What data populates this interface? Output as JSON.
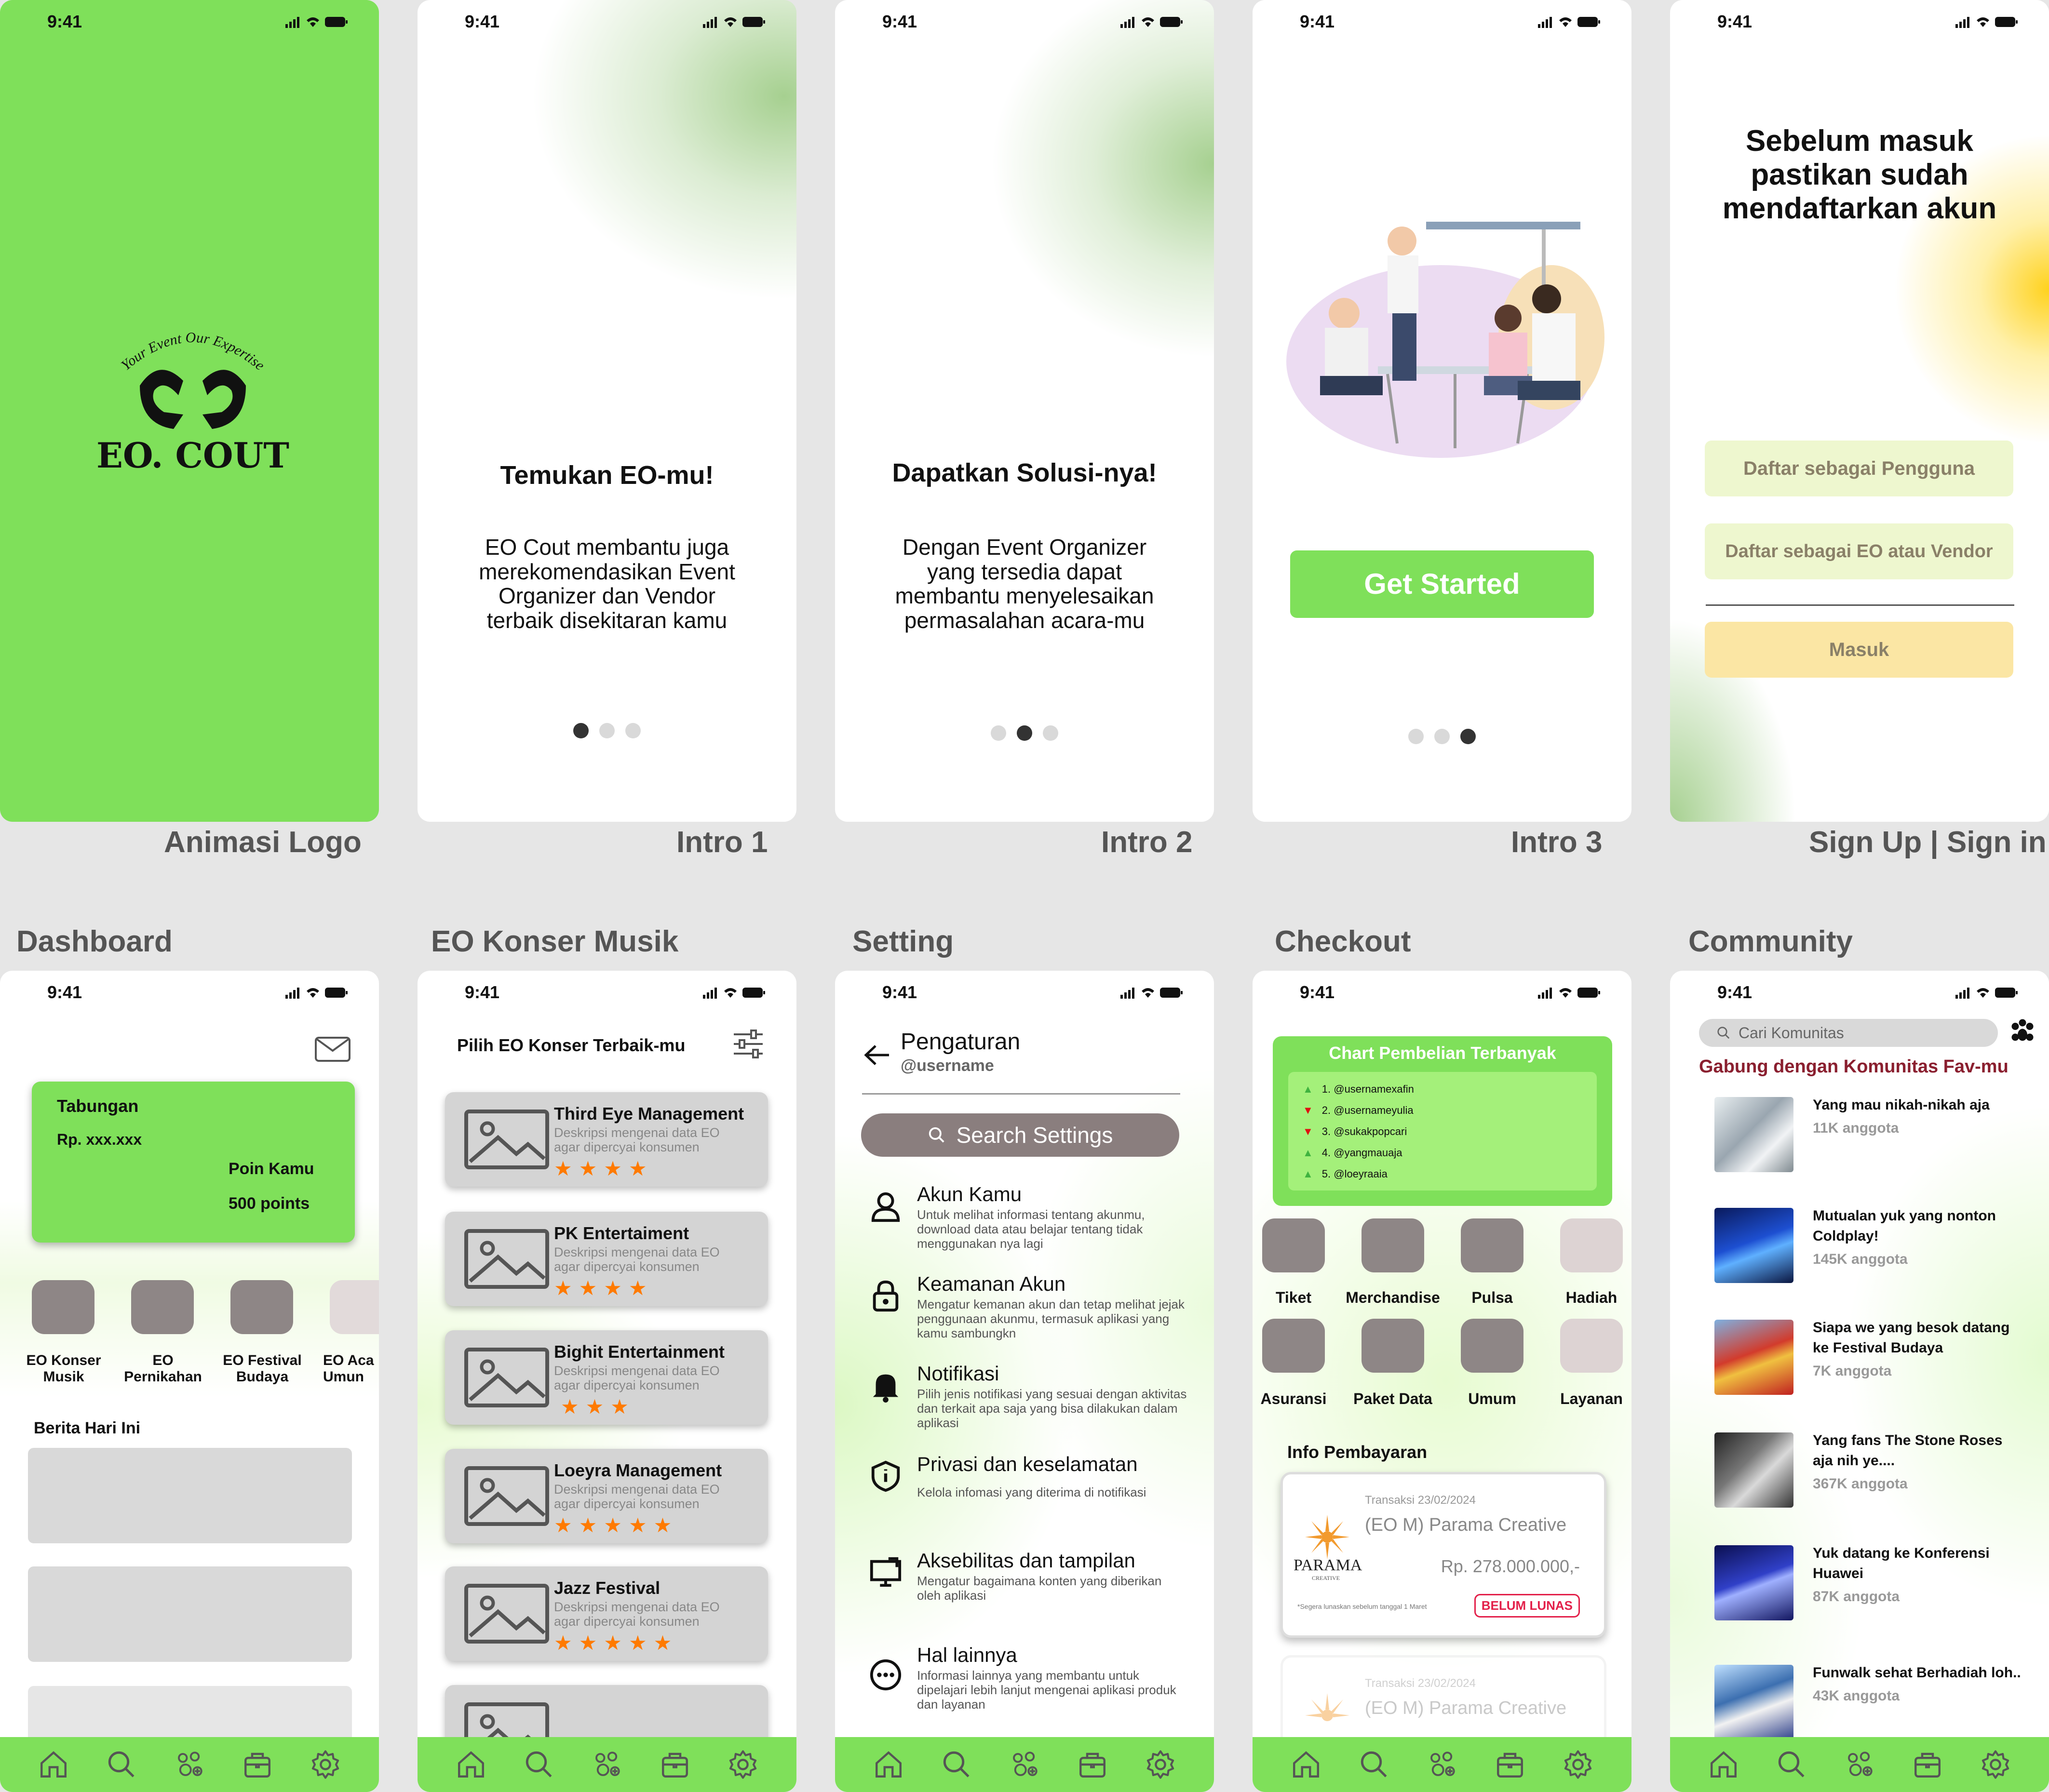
{
  "status_time": "9:41",
  "captions": {
    "logo": "Animasi Logo",
    "intro1": "Intro 1",
    "intro2": "Intro 2",
    "intro3": "Intro 3",
    "signup": "Sign Up | Sign in",
    "dashboard": "Dashboard",
    "eo_musik": "EO Konser Musik",
    "setting": "Setting",
    "checkout": "Checkout",
    "community": "Community"
  },
  "logo": {
    "tagline": "Your Event Our Expertise",
    "name": "EO. COUT",
    "bg": "#7fe05a"
  },
  "intro1": {
    "title": "Temukan EO-mu!",
    "body": "EO Cout membantu juga merekomendasikan Event Organizer dan Vendor terbaik disekitaran kamu"
  },
  "intro2": {
    "title": "Dapatkan Solusi-nya!",
    "body": "Dengan Event Organizer yang tersedia dapat membantu menyelesaikan permasalahan acara-mu"
  },
  "intro3": {
    "button": "Get Started"
  },
  "signup": {
    "title": "Sebelum masuk pastikan sudah mendaftarkan akun",
    "btn_user": "Daftar sebagai Pengguna",
    "btn_eo": "Daftar sebagai EO atau Vendor",
    "btn_login": "Masuk"
  },
  "dashboard": {
    "savings_label": "Tabungan",
    "savings_value": "Rp. xxx.xxx",
    "points_label": "Poin Kamu",
    "points_value": "500 points",
    "categories": [
      "EO Konser Musik",
      "EO Pernikahan",
      "EO Festival Budaya",
      "EO Aca Umun"
    ],
    "news_title": "Berita Hari Ini"
  },
  "eo_musik": {
    "title": "Pilih EO Konser Terbaik-mu",
    "desc": "Deskripsi mengenai data EO agar dipercyai konsumen",
    "items": [
      {
        "name": "Third Eye Management",
        "stars": "★★★★"
      },
      {
        "name": "PK Entertaiment",
        "stars": "★★★★"
      },
      {
        "name": "Bighit Entertainment",
        "stars": "★★★"
      },
      {
        "name": "Loeyra Management",
        "stars": "★★★★★"
      },
      {
        "name": "Jazz Festival",
        "stars": "★★★★★"
      }
    ]
  },
  "setting": {
    "title": "Pengaturan",
    "username": "@username",
    "search": "Search Settings",
    "items": [
      {
        "title": "Akun Kamu",
        "desc": "Untuk melihat informasi tentang akunmu, download data atau belajar tentang tidak menggunakan nya lagi"
      },
      {
        "title": "Keamanan Akun",
        "desc": "Mengatur kemanan akun dan tetap melihat jejak penggunaan akunmu, termasuk aplikasi yang kamu sambungkn"
      },
      {
        "title": "Notifikasi",
        "desc": "Pilih jenis notifikasi yang sesuai dengan aktivitas dan terkait apa saja yang bisa dilakukan dalam aplikasi"
      },
      {
        "title": "Privasi dan keselamatan",
        "desc": "Kelola infomasi yang diterima di notifikasi"
      },
      {
        "title": "Aksebilitas dan tampilan",
        "desc": "Mengatur bagaimana konten yang diberikan oleh aplikasi"
      },
      {
        "title": "Hal lainnya",
        "desc": "Informasi lainnya yang membantu untuk dipelajari lebih lanjut mengenai aplikasi produk dan layanan"
      }
    ]
  },
  "checkout": {
    "chart_title": "Chart Pembelian Terbanyak",
    "ranks": [
      "1. @usernamexafin",
      "2. @usernameyulia",
      "3. @sukakpopcari",
      "4. @yangmauaja",
      "5. @loeyraaia"
    ],
    "menu": [
      "Tiket",
      "Merchandise",
      "Pulsa",
      "Hadiah",
      "Asuransi",
      "Paket Data",
      "Umum",
      "Layanan"
    ],
    "pay_title": "Info Pembayaran",
    "tx_date": "Transaksi 23/02/2024",
    "tx_name": "(EO M) Parama Creative",
    "tx_amount": "Rp. 278.000.000,-",
    "tx_note": "*Segera lunaskan sebelum tanggal 1 Maret",
    "tx_status": "BELUM LUNAS",
    "brand": "PARAMA",
    "brand_sub": "CREATIVE"
  },
  "community": {
    "search": "Cari Komunitas",
    "heading": "Gabung dengan Komunitas Fav-mu",
    "items": [
      {
        "name": "Yang mau nikah-nikah aja",
        "count": "11K anggota"
      },
      {
        "name": "Mutualan yuk yang nonton Coldplay!",
        "count": "145K anggota"
      },
      {
        "name": "Siapa we yang besok datang ke Festival Budaya",
        "count": "7K anggota"
      },
      {
        "name": "Yang fans The Stone Roses aja nih ye....",
        "count": "367K anggota"
      },
      {
        "name": "Yuk datang ke Konferensi Huawei",
        "count": "87K anggota"
      },
      {
        "name": "Funwalk sehat Berhadiah loh..",
        "count": "43K anggota"
      }
    ]
  }
}
